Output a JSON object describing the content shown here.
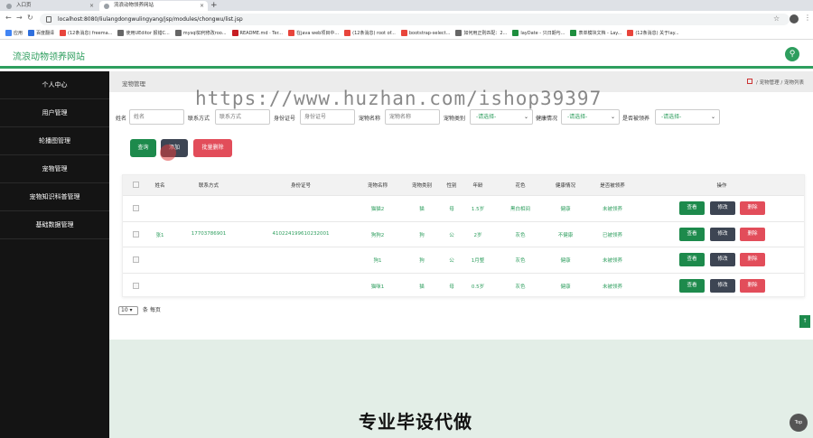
{
  "browser": {
    "tabs": [
      {
        "title": "入口页"
      },
      {
        "title": "流浪动物领养网站"
      }
    ],
    "new_tab": "+",
    "url": "localhost:8080/liulangdongwulingyang/jsp/modules/chongwu/list.jsp",
    "bookmarks": [
      {
        "label": "应用",
        "color": "#4285f4"
      },
      {
        "label": "百度翻译",
        "color": "#2f6fdd"
      },
      {
        "label": "(12条消息) freema...",
        "color": "#e8453c"
      },
      {
        "label": "使用UEditor 报错C...",
        "color": "#666666"
      },
      {
        "label": "mysql如何修改roo...",
        "color": "#666666"
      },
      {
        "label": "README.md · Ter...",
        "color": "#c71d23"
      },
      {
        "label": "在java web项目中...",
        "color": "#e8453c"
      },
      {
        "label": "(12条消息) root of...",
        "color": "#e8453c"
      },
      {
        "label": "bootstrap-select...",
        "color": "#e8453c"
      },
      {
        "label": "如何用正则匹配：2...",
        "color": "#666666"
      },
      {
        "label": "layDate - 只日期与...",
        "color": "#1e8e3e"
      },
      {
        "label": "表单模块文档 - Lay...",
        "color": "#1e8e3e"
      },
      {
        "label": "(12条消息) 关于lay...",
        "color": "#e8453c"
      }
    ]
  },
  "header": {
    "site_title": "流浪动物领养网站"
  },
  "sidebar": {
    "items": [
      {
        "label": "个人中心"
      },
      {
        "label": "用户管理"
      },
      {
        "label": "轮播图管理"
      },
      {
        "label": "宠物管理"
      },
      {
        "label": "宠物知识科普管理"
      },
      {
        "label": "基础数据管理"
      }
    ]
  },
  "page": {
    "heading": "宠物管理",
    "breadcrumb": [
      "宠物管理",
      "宠物列表"
    ],
    "breadcrumb_sep": "/"
  },
  "filters": {
    "name": {
      "label": "姓名",
      "placeholder": "姓名"
    },
    "phone": {
      "label": "联系方式",
      "placeholder": "联系方式"
    },
    "idcard": {
      "label": "身份证号",
      "placeholder": "身份证号"
    },
    "pet_name": {
      "label": "宠物名称",
      "placeholder": "宠物名称"
    },
    "pet_type": {
      "label": "宠物类别",
      "value": "-请选择-"
    },
    "health": {
      "label": "健康情况",
      "value": "-请选择-"
    },
    "adopted": {
      "label": "是否被领养",
      "value": "-请选择-"
    }
  },
  "actions": {
    "search": "查询",
    "add": "添加",
    "batch_delete": "批量删除"
  },
  "table": {
    "columns": [
      "姓名",
      "联系方式",
      "身份证号",
      "宠物名称",
      "宠物类别",
      "性别",
      "年龄",
      "花色",
      "健康情况",
      "是否被领养",
      "操作"
    ],
    "rows": [
      {
        "name": "",
        "phone": "",
        "idcard": "",
        "pet_name": "猫猫2",
        "pet_type": "猫",
        "sex": "母",
        "age": "1.5岁",
        "color": "黑白相间",
        "health": "健康",
        "adopted": "未被领养"
      },
      {
        "name": "张1",
        "phone": "17703786901",
        "idcard": "410224199610232001",
        "pet_name": "狗狗2",
        "pet_type": "狗",
        "sex": "公",
        "age": "2岁",
        "color": "灰色",
        "health": "不健康",
        "adopted": "已被领养"
      },
      {
        "name": "",
        "phone": "",
        "idcard": "",
        "pet_name": "狗1",
        "pet_type": "狗",
        "sex": "公",
        "age": "1月整",
        "color": "灰色",
        "health": "健康",
        "adopted": "未被领养"
      },
      {
        "name": "",
        "phone": "",
        "idcard": "",
        "pet_name": "猫咪1",
        "pet_type": "猫",
        "sex": "母",
        "age": "0.5岁",
        "color": "灰色",
        "health": "健康",
        "adopted": "未被领养"
      }
    ],
    "row_actions": {
      "view": "查看",
      "edit": "修改",
      "delete": "删除"
    }
  },
  "pagination": {
    "page_size": "10",
    "per_page_label": "条 每页"
  },
  "scroll_up": "↑",
  "promo_text": "专业毕设代做",
  "back_to_top": "Top",
  "watermark": "https://www.huzhan.com/ishop39397",
  "colors": {
    "accent_green": "#2e9e5e",
    "button_green": "#1d8a4c",
    "button_dark": "#3d4553",
    "button_red": "#e24d5a",
    "sidebar_bg": "#141414"
  }
}
